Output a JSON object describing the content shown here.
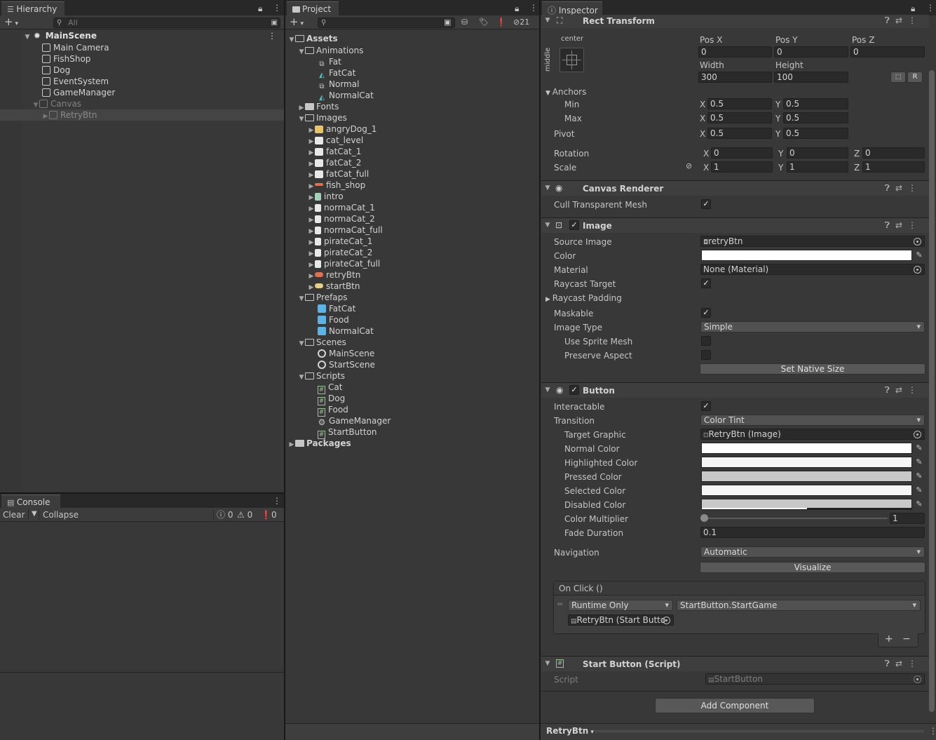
{
  "hierarchy": {
    "tab": "Hierarchy",
    "search_placeholder": "All",
    "scene": "MainScene",
    "items": [
      "Main Camera",
      "FishShop",
      "Dog",
      "EventSystem",
      "GameManager",
      "Canvas",
      "RetryBtn"
    ]
  },
  "console": {
    "tab": "Console",
    "clear": "Clear",
    "collapse": "Collapse",
    "log_count": "0",
    "warn_count": "0",
    "error_count": "0"
  },
  "project": {
    "tab": "Project",
    "hidden_count": "21",
    "tree": {
      "assets": "Assets",
      "animations": "Animations",
      "anim_items": [
        "Fat",
        "FatCat",
        "Normal",
        "NormalCat"
      ],
      "fonts": "Fonts",
      "images": "Images",
      "image_items": [
        "angryDog_1",
        "cat_level",
        "fatCat_1",
        "fatCat_2",
        "fatCat_full",
        "fish_shop",
        "intro",
        "normaCat_1",
        "normaCat_2",
        "normaCat_full",
        "pirateCat_1",
        "pirateCat_2",
        "pirateCat_full",
        "retryBtn",
        "startBtn"
      ],
      "prefaps": "Prefaps",
      "prefab_items": [
        "FatCat",
        "Food",
        "NormalCat"
      ],
      "scenes": "Scenes",
      "scene_items": [
        "MainScene",
        "StartScene"
      ],
      "scripts": "Scripts",
      "script_items": [
        "Cat",
        "Dog",
        "Food",
        "GameManager",
        "StartButton"
      ],
      "packages": "Packages"
    }
  },
  "inspector": {
    "tab": "Inspector",
    "rect_transform": {
      "title": "Rect Transform",
      "anchor_h": "center",
      "anchor_v": "middle",
      "pos_x_label": "Pos X",
      "pos_y_label": "Pos Y",
      "pos_z_label": "Pos Z",
      "pos_x": "0",
      "pos_y": "0",
      "pos_z": "0",
      "width_label": "Width",
      "height_label": "Height",
      "width": "300",
      "height": "100",
      "r_button": "R",
      "anchors_label": "Anchors",
      "min_label": "Min",
      "max_label": "Max",
      "pivot_label": "Pivot",
      "min_x": "0.5",
      "min_y": "0.5",
      "max_x": "0.5",
      "max_y": "0.5",
      "pivot_x": "0.5",
      "pivot_y": "0.5",
      "rotation_label": "Rotation",
      "scale_label": "Scale",
      "rot_x": "0",
      "rot_y": "0",
      "rot_z": "0",
      "scale_x": "1",
      "scale_y": "1",
      "scale_z": "1",
      "x": "X",
      "y": "Y",
      "z": "Z"
    },
    "canvas_renderer": {
      "title": "Canvas Renderer",
      "cull_label": "Cull Transparent Mesh"
    },
    "image": {
      "title": "Image",
      "source_label": "Source Image",
      "source_value": "retryBtn",
      "color_label": "Color",
      "color_value": "#ffffff",
      "material_label": "Material",
      "material_value": "None (Material)",
      "raycast_target_label": "Raycast Target",
      "raycast_padding_label": "Raycast Padding",
      "maskable_label": "Maskable",
      "image_type_label": "Image Type",
      "image_type_value": "Simple",
      "use_sprite_mesh_label": "Use Sprite Mesh",
      "preserve_aspect_label": "Preserve Aspect",
      "native_size_button": "Set Native Size"
    },
    "button": {
      "title": "Button",
      "interactable_label": "Interactable",
      "transition_label": "Transition",
      "transition_value": "Color Tint",
      "target_graphic_label": "Target Graphic",
      "target_graphic_value": "RetryBtn (Image)",
      "normal_color_label": "Normal Color",
      "highlighted_color_label": "Highlighted Color",
      "pressed_color_label": "Pressed Color",
      "selected_color_label": "Selected Color",
      "disabled_color_label": "Disabled Color",
      "color_multiplier_label": "Color Multiplier",
      "color_multiplier_value": "1",
      "fade_duration_label": "Fade Duration",
      "fade_duration_value": "0.1",
      "navigation_label": "Navigation",
      "navigation_value": "Automatic",
      "visualize_button": "Visualize",
      "onclick_label": "On Click ()",
      "runtime_value": "Runtime Only",
      "function_value": "StartButton.StartGame",
      "target_object": "RetryBtn (Start Butto",
      "plus": "+",
      "minus": "−",
      "colors": {
        "normal": "#ffffff",
        "highlighted": "#f5f5f5",
        "pressed": "#c8c8c8",
        "selected": "#f5f5f5",
        "disabled": "#c8c8c8"
      }
    },
    "start_button": {
      "title": "Start Button (Script)",
      "script_label": "Script",
      "script_value": "StartButton"
    },
    "add_component": "Add Component",
    "footer_object": "RetryBtn"
  }
}
